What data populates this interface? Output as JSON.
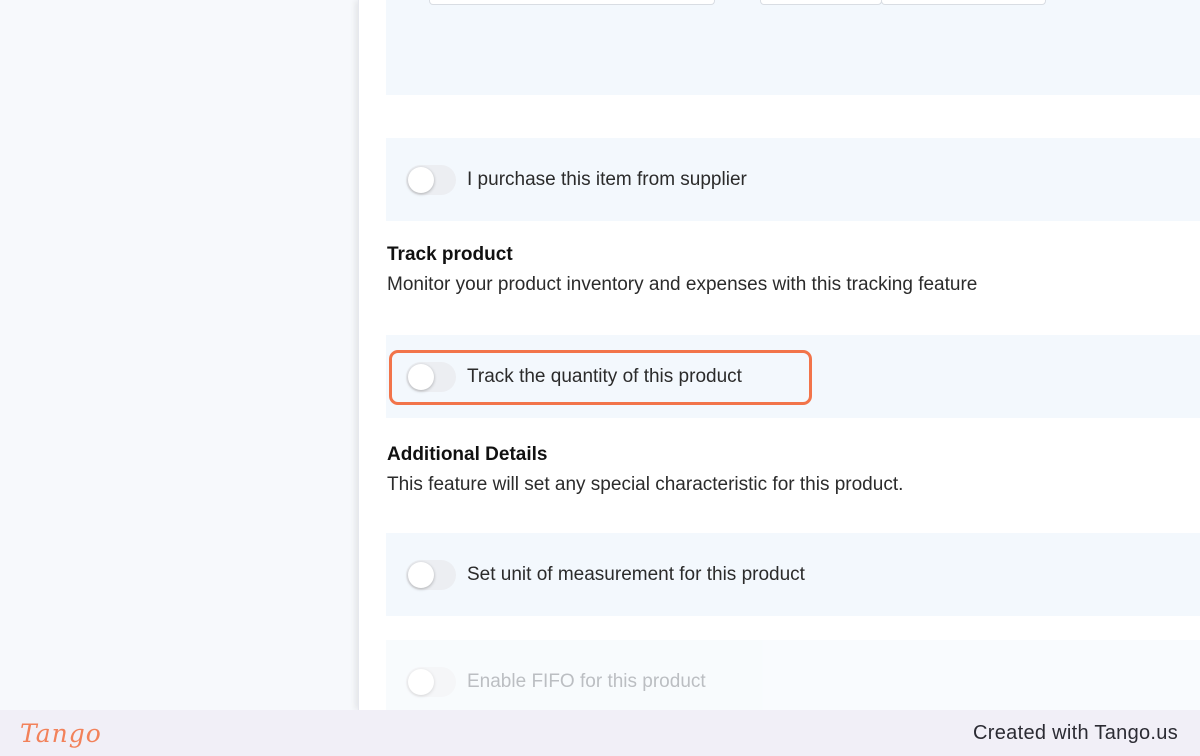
{
  "rows": {
    "purchase": "I purchase this item from supplier",
    "track_quantity": "Track the quantity of this product",
    "unit_measurement": "Set unit of measurement for this product",
    "fifo": "Enable FIFO for this product"
  },
  "track_section": {
    "title": "Track product",
    "description": "Monitor your product inventory and expenses with this tracking feature"
  },
  "additional_section": {
    "title": "Additional Details",
    "description": "This feature will set any special characteristic for this product."
  },
  "footer": {
    "logo": "Tango",
    "credit": "Created with Tango.us"
  },
  "colors": {
    "highlight": "#f2744a",
    "row_background": "#f3f8fd",
    "footer_background": "#f1eff7"
  }
}
